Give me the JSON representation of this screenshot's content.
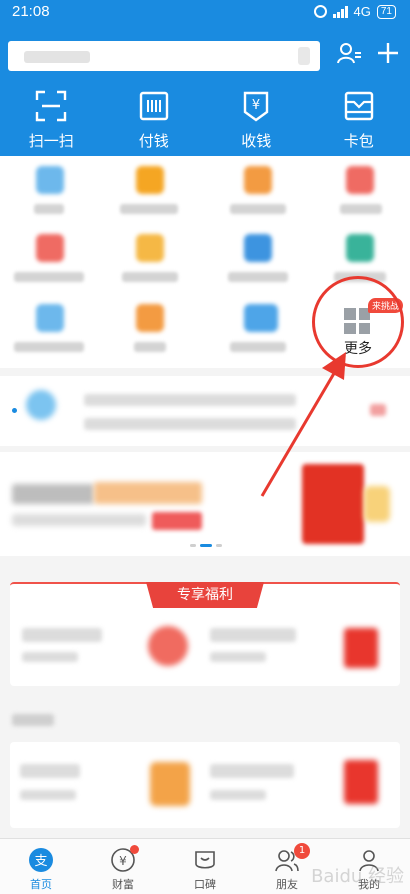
{
  "status_bar": {
    "time": "21:08",
    "network": "4G",
    "battery": "71"
  },
  "header": {
    "quick_actions": [
      {
        "label": "扫一扫",
        "icon": "scan-icon"
      },
      {
        "label": "付钱",
        "icon": "pay-icon"
      },
      {
        "label": "收钱",
        "icon": "collect-money-icon"
      },
      {
        "label": "卡包",
        "icon": "card-wallet-icon"
      }
    ]
  },
  "apps": {
    "more_label": "更多",
    "more_badge": "来挑战"
  },
  "benefits": {
    "title": "专享福利"
  },
  "tab_bar": {
    "items": [
      {
        "label": "首页",
        "icon": "home-icon"
      },
      {
        "label": "财富",
        "icon": "wealth-icon"
      },
      {
        "label": "口碑",
        "icon": "koubei-icon"
      },
      {
        "label": "朋友",
        "icon": "friends-icon",
        "badge": "1"
      },
      {
        "label": "我的",
        "icon": "profile-icon"
      }
    ],
    "active": "首页"
  },
  "colors": {
    "primary": "#1a8be0",
    "annotation": "#e8392f",
    "badge": "#f04a3c"
  }
}
